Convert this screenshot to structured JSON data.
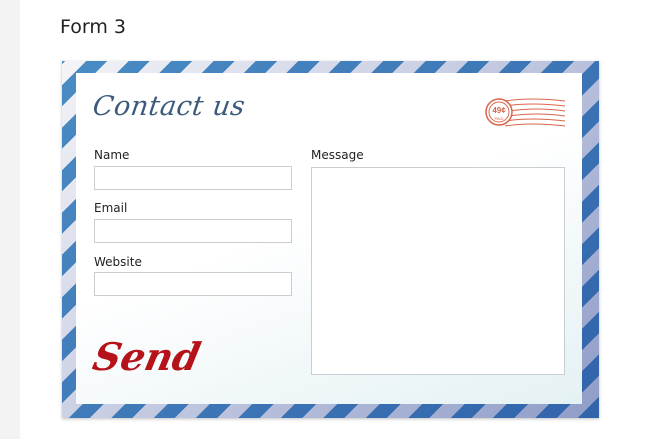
{
  "page": {
    "title": "Form 3"
  },
  "form": {
    "heading": "Contact us",
    "stamp": {
      "price": "49¢",
      "caption": "PAID"
    },
    "fields": {
      "name": {
        "label": "Name",
        "value": ""
      },
      "email": {
        "label": "Email",
        "value": ""
      },
      "website": {
        "label": "Website",
        "value": ""
      },
      "message": {
        "label": "Message",
        "value": ""
      }
    },
    "send_label": "Send"
  },
  "colors": {
    "stripe": "#4a8cc4",
    "heading": "#3d5a7d",
    "send": "#b6121a",
    "stamp": "#d9664a"
  }
}
